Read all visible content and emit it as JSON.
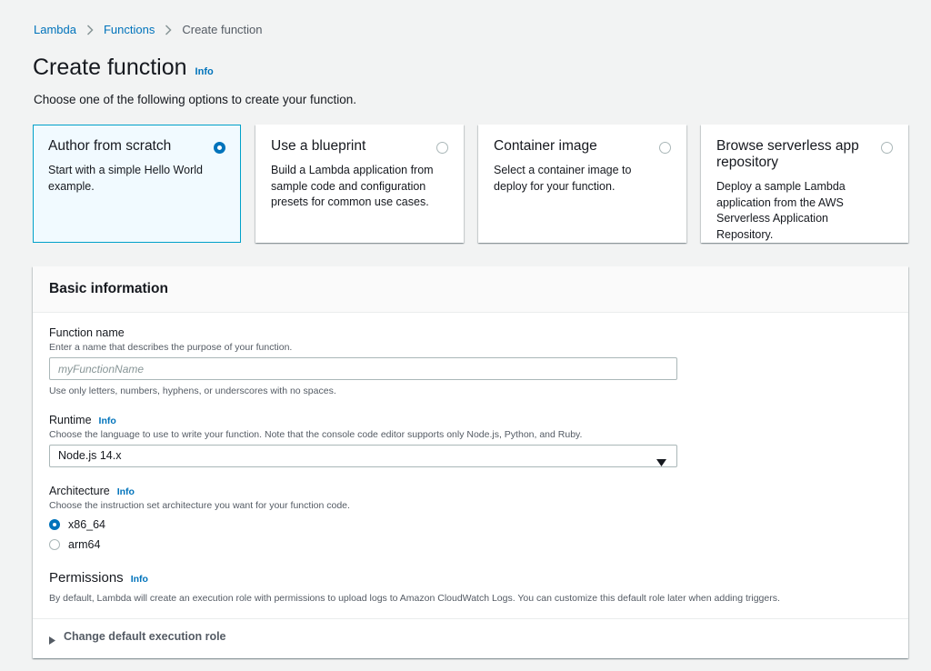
{
  "breadcrumb": {
    "items": [
      {
        "label": "Lambda"
      },
      {
        "label": "Functions"
      },
      {
        "label": "Create function"
      }
    ]
  },
  "page": {
    "title": "Create function",
    "info_label": "Info",
    "subtitle": "Choose one of the following options to create your function."
  },
  "options": [
    {
      "title": "Author from scratch",
      "description": "Start with a simple Hello World example.",
      "selected": true
    },
    {
      "title": "Use a blueprint",
      "description": "Build a Lambda application from sample code and configuration presets for common use cases.",
      "selected": false
    },
    {
      "title": "Container image",
      "description": "Select a container image to deploy for your function.",
      "selected": false
    },
    {
      "title": "Browse serverless app repository",
      "description": "Deploy a sample Lambda application from the AWS Serverless Application Repository.",
      "selected": false
    }
  ],
  "basic_info": {
    "title": "Basic information",
    "function_name": {
      "label": "Function name",
      "description": "Enter a name that describes the purpose of your function.",
      "placeholder": "myFunctionName",
      "value": "",
      "constraint": "Use only letters, numbers, hyphens, or underscores with no spaces."
    },
    "runtime": {
      "label": "Runtime",
      "info_label": "Info",
      "description": "Choose the language to use to write your function. Note that the console code editor supports only Node.js, Python, and Ruby.",
      "selected": "Node.js 14.x"
    },
    "architecture": {
      "label": "Architecture",
      "info_label": "Info",
      "description": "Choose the instruction set architecture you want for your function code.",
      "options": [
        {
          "label": "x86_64",
          "checked": true
        },
        {
          "label": "arm64",
          "checked": false
        }
      ]
    },
    "permissions": {
      "label": "Permissions",
      "info_label": "Info",
      "description": "By default, Lambda will create an execution role with permissions to upload logs to Amazon CloudWatch Logs. You can customize this default role later when adding triggers."
    },
    "expander_label": "Change default execution role"
  },
  "colors": {
    "link": "#0073bb",
    "selected_border": "#00a1c9",
    "selected_bg": "#f1faff"
  }
}
